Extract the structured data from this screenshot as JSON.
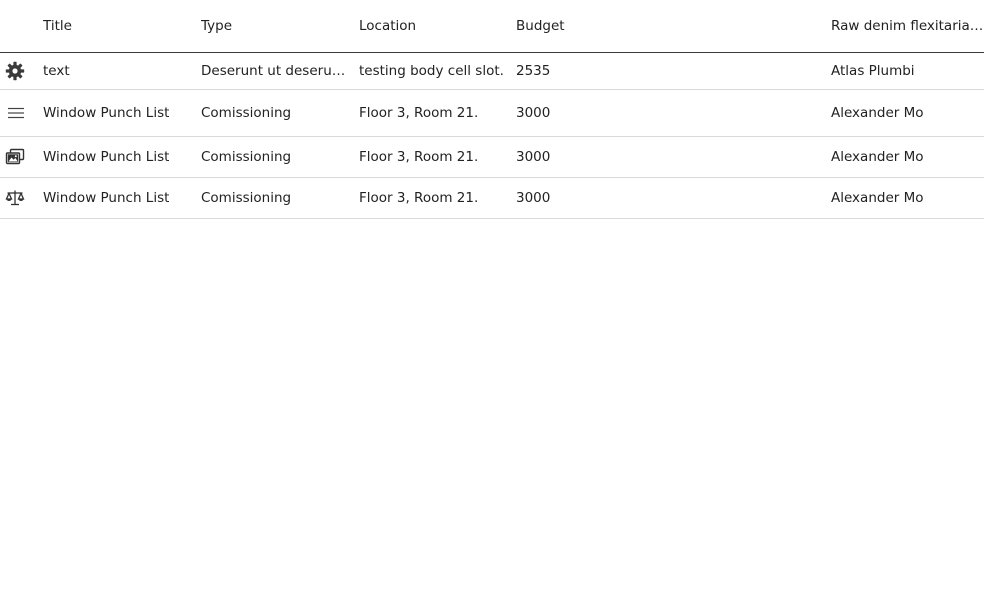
{
  "columns": {
    "title": "Title",
    "type": "Type",
    "location": "Location",
    "budget": "Budget",
    "extra": "Raw denim flexitarian g"
  },
  "rows": [
    {
      "icon": "gear-icon",
      "title": "text",
      "type": "Deserunt ut deserun…",
      "location": "testing body cell slot.",
      "budget": "2535",
      "extra": "Atlas Plumbi"
    },
    {
      "icon": "menu-lines-icon",
      "title": "Window Punch List",
      "type": "Comissioning",
      "location": "Floor 3, Room 21.",
      "budget": "3000",
      "extra": "Alexander Mo"
    },
    {
      "icon": "image-gallery-icon",
      "title": "Window Punch List",
      "type": "Comissioning",
      "location": "Floor 3, Room 21.",
      "budget": "3000",
      "extra": "Alexander Mo"
    },
    {
      "icon": "scale-balance-icon",
      "title": "Window Punch List",
      "type": "Comissioning",
      "location": "Floor 3, Room 21.",
      "budget": "3000",
      "extra": "Alexander Mo"
    }
  ]
}
